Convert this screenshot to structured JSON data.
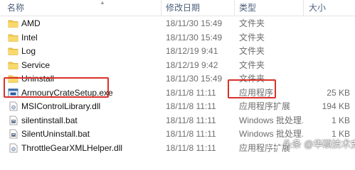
{
  "columns": {
    "name": "名称",
    "date": "修改日期",
    "type": "类型",
    "size": "大小"
  },
  "files": [
    {
      "name": "AMD",
      "date": "18/11/30 15:49",
      "type": "文件夹",
      "size": "",
      "icon": "folder-icon"
    },
    {
      "name": "Intel",
      "date": "18/11/30 15:49",
      "type": "文件夹",
      "size": "",
      "icon": "folder-icon"
    },
    {
      "name": "Log",
      "date": "18/12/19 9:41",
      "type": "文件夹",
      "size": "",
      "icon": "folder-icon"
    },
    {
      "name": "Service",
      "date": "18/12/19 9:42",
      "type": "文件夹",
      "size": "",
      "icon": "folder-icon"
    },
    {
      "name": "Uninstall",
      "date": "18/11/30 15:49",
      "type": "文件夹",
      "size": "",
      "icon": "folder-icon"
    },
    {
      "name": "ArmouryCrateSetup.exe",
      "date": "18/11/8 11:11",
      "type": "应用程序",
      "size": "25 KB",
      "icon": "exe-icon"
    },
    {
      "name": "MSIControlLibrary.dll",
      "date": "18/11/8 11:11",
      "type": "应用程序扩展",
      "size": "194 KB",
      "icon": "dll-icon"
    },
    {
      "name": "silentinstall.bat",
      "date": "18/11/8 11:11",
      "type": "Windows 批处理...",
      "size": "1 KB",
      "icon": "bat-icon"
    },
    {
      "name": "SilentUninstall.bat",
      "date": "18/11/8 11:11",
      "type": "Windows 批处理...",
      "size": "1 KB",
      "icon": "bat-icon"
    },
    {
      "name": "ThrottleGearXMLHelper.dll",
      "date": "18/11/8 11:11",
      "type": "应用程序扩展",
      "size": "",
      "icon": "dll-icon"
    }
  ],
  "watermark": {
    "text": "头条 @华硕技术支持"
  },
  "colors": {
    "highlight": "#d9302a",
    "folder": "#f3c94f",
    "header_text": "#4c607a"
  }
}
